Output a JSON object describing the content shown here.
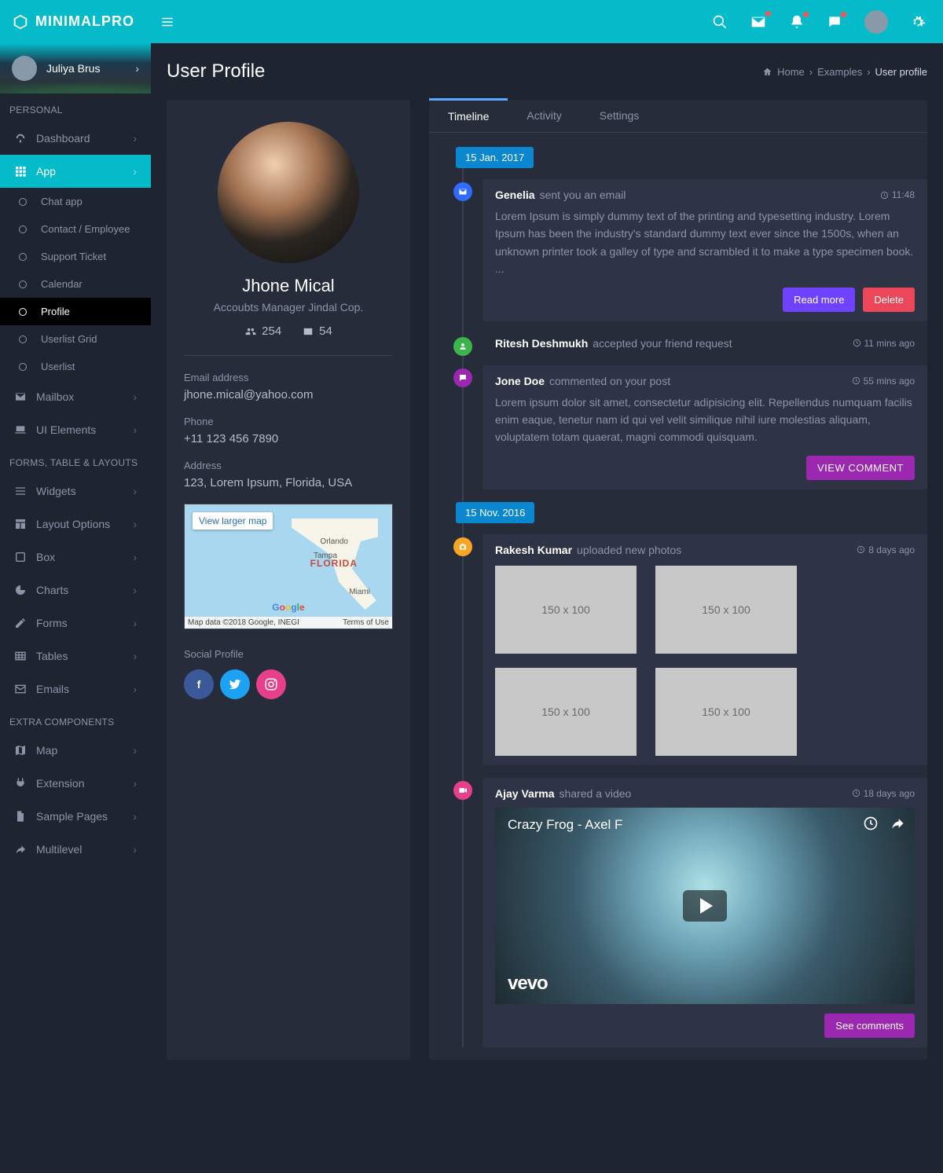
{
  "brand": "MINIMALPRO",
  "user": {
    "name": "Juliya Brus"
  },
  "page": {
    "title": "User Profile"
  },
  "crumbs": {
    "home": "Home",
    "mid": "Examples",
    "cur": "User profile"
  },
  "sidebar": {
    "sections": [
      {
        "header": "PERSONAL",
        "items": [
          {
            "label": "Dashboard",
            "chev": true,
            "icon": "dashboard"
          },
          {
            "label": "App",
            "chev": true,
            "icon": "grid",
            "active": true,
            "sub": [
              {
                "label": "Chat app"
              },
              {
                "label": "Contact / Employee"
              },
              {
                "label": "Support Ticket"
              },
              {
                "label": "Calendar"
              },
              {
                "label": "Profile",
                "sel": true
              },
              {
                "label": "Userlist Grid"
              },
              {
                "label": "Userlist"
              }
            ]
          },
          {
            "label": "Mailbox",
            "chev": true,
            "icon": "mail"
          },
          {
            "label": "UI Elements",
            "chev": true,
            "icon": "laptop"
          }
        ]
      },
      {
        "header": "FORMS, TABLE & LAYOUTS",
        "items": [
          {
            "label": "Widgets",
            "chev": true,
            "icon": "menu"
          },
          {
            "label": "Layout Options",
            "chev": true,
            "icon": "layout"
          },
          {
            "label": "Box",
            "chev": true,
            "icon": "box"
          },
          {
            "label": "Charts",
            "chev": true,
            "icon": "pie"
          },
          {
            "label": "Forms",
            "chev": true,
            "icon": "edit"
          },
          {
            "label": "Tables",
            "chev": true,
            "icon": "table"
          },
          {
            "label": "Emails",
            "chev": true,
            "icon": "envelope"
          }
        ]
      },
      {
        "header": "EXTRA COMPONENTS",
        "items": [
          {
            "label": "Map",
            "chev": true,
            "icon": "map"
          },
          {
            "label": "Extension",
            "chev": true,
            "icon": "plug"
          },
          {
            "label": "Sample Pages",
            "chev": true,
            "icon": "file"
          },
          {
            "label": "Multilevel",
            "chev": true,
            "icon": "share"
          }
        ]
      }
    ]
  },
  "profile": {
    "name": "Jhone Mical",
    "role": "Accoubts Manager Jindal Cop.",
    "stat1": "254",
    "stat2": "54",
    "email_label": "Email address",
    "email": "jhone.mical@yahoo.com",
    "phone_label": "Phone",
    "phone": "+11 123 456 7890",
    "address_label": "Address",
    "address": "123, Lorem Ipsum, Florida, USA",
    "social_label": "Social Profile",
    "map": {
      "larger": "View larger map",
      "attr": "Map data ©2018 Google, INEGI",
      "terms": "Terms of Use",
      "state": "FLORIDA",
      "cities": [
        "Orlando",
        "Tampa",
        "Miami"
      ]
    }
  },
  "tabs": [
    "Timeline",
    "Activity",
    "Settings"
  ],
  "dates": [
    "15 Jan. 2017",
    "15 Nov. 2016"
  ],
  "timeline": {
    "i0": {
      "who": "Genelia",
      "act": "sent you an email",
      "time": "11:48",
      "text": "Lorem Ipsum is simply dummy text of the printing and typesetting industry. Lorem Ipsum has been the industry's standard dummy text ever since the 1500s, when an unknown printer took a galley of type and scrambled it to make a type specimen book. ...",
      "btn1": "Read more",
      "btn2": "Delete"
    },
    "i1": {
      "who": "Ritesh Deshmukh",
      "act": "accepted your friend request",
      "time": "11 mins ago"
    },
    "i2": {
      "who": "Jone Doe",
      "act": "commented on your post",
      "time": "55 mins ago",
      "text": "Lorem ipsum dolor sit amet, consectetur adipisicing elit. Repellendus numquam facilis enim eaque, tenetur nam id qui vel velit similique nihil iure molestias aliquam, voluptatem totam quaerat, magni commodi quisquam.",
      "btn": "VIEW COMMENT"
    },
    "i3": {
      "who": "Rakesh Kumar",
      "act": "uploaded new photos",
      "time": "8 days ago",
      "ph": "150 x 100"
    },
    "i4": {
      "who": "Ajay Varma",
      "act": "shared a video",
      "time": "18 days ago",
      "vtitle": "Crazy Frog - Axel F",
      "vlogo": "vevo",
      "btn": "See comments"
    }
  }
}
